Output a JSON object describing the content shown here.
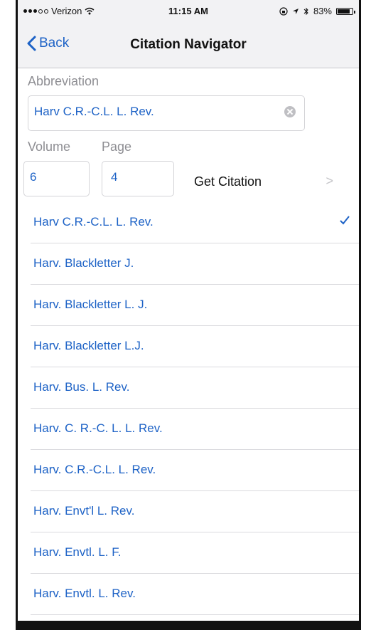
{
  "status": {
    "carrier": "Verizon",
    "time": "11:15 AM",
    "battery": "83%",
    "battery_level": 0.83
  },
  "nav": {
    "back_label": "Back",
    "title": "Citation Navigator"
  },
  "form": {
    "abbreviation_label": "Abbreviation",
    "abbreviation_value": "Harv C.R.-C.L. L. Rev.",
    "volume_label": "Volume",
    "volume_value": "6",
    "page_label": "Page",
    "page_value": "4",
    "get_citation_label": "Get Citation",
    "chevron": ">"
  },
  "results": [
    {
      "label": "Harv C.R.-C.L. L. Rev.",
      "selected": true
    },
    {
      "label": "Harv. Blackletter J."
    },
    {
      "label": "Harv. Blackletter L. J."
    },
    {
      "label": "Harv. Blackletter L.J."
    },
    {
      "label": "Harv. Bus. L. Rev."
    },
    {
      "label": "Harv. C. R.-C. L. L. Rev."
    },
    {
      "label": "Harv. C.R.-C.L. L. Rev."
    },
    {
      "label": "Harv. Envt'l L. Rev."
    },
    {
      "label": "Harv. Envtl. L. F."
    },
    {
      "label": "Harv. Envtl. L. Rev."
    }
  ],
  "colors": {
    "accent": "#1d62c6"
  }
}
